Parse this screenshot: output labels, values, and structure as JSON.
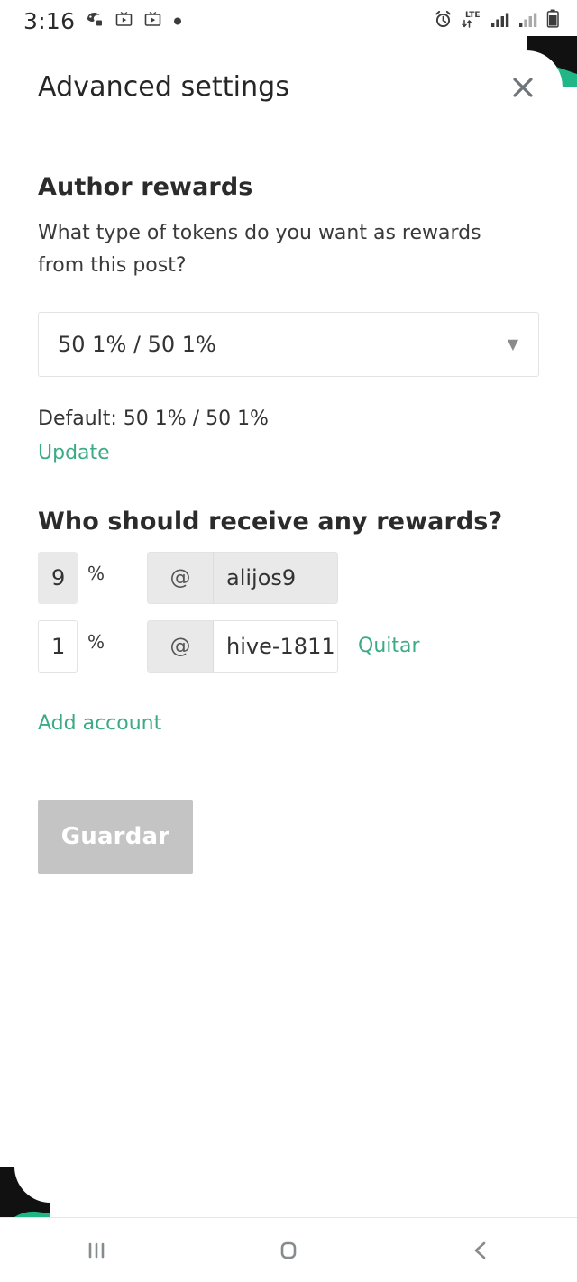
{
  "status_bar": {
    "time": "3:16",
    "left_icons": [
      "notification-icon",
      "media-cast-icon",
      "media-cast-icon",
      "dot-icon"
    ],
    "right_icons": [
      "alarm-icon",
      "lte-data-icon",
      "signal-bars-icon",
      "signal-bars-icon",
      "battery-icon"
    ],
    "network_label": "LTE"
  },
  "header": {
    "title": "Advanced settings",
    "close_label": "×"
  },
  "author_rewards": {
    "heading": "Author rewards",
    "description": "What type of tokens do you want as rewards from this post?",
    "selected_option": "50 1% / 50 1%",
    "caret": "▼",
    "default_text": "Default: 50 1% / 50 1%",
    "update_label": "Update"
  },
  "beneficiaries": {
    "heading": "Who should receive any rewards?",
    "percent_sign": "%",
    "at_sign": "@",
    "rows": [
      {
        "percent": "9",
        "account": "alijos9",
        "editable": false,
        "remove_label": ""
      },
      {
        "percent": "1",
        "account": "hive-1811",
        "editable": true,
        "remove_label": "Quitar"
      }
    ],
    "add_label": "Add account"
  },
  "actions": {
    "save_label": "Guardar"
  },
  "nav_bar": {
    "recents_label": "recents-icon",
    "home_label": "home-icon",
    "back_label": "back-icon"
  },
  "colors": {
    "accent_green": "#3cab85",
    "disabled_gray": "#c4c4c4",
    "field_gray": "#e9e9e9",
    "text_dark": "#2b2b2b"
  }
}
